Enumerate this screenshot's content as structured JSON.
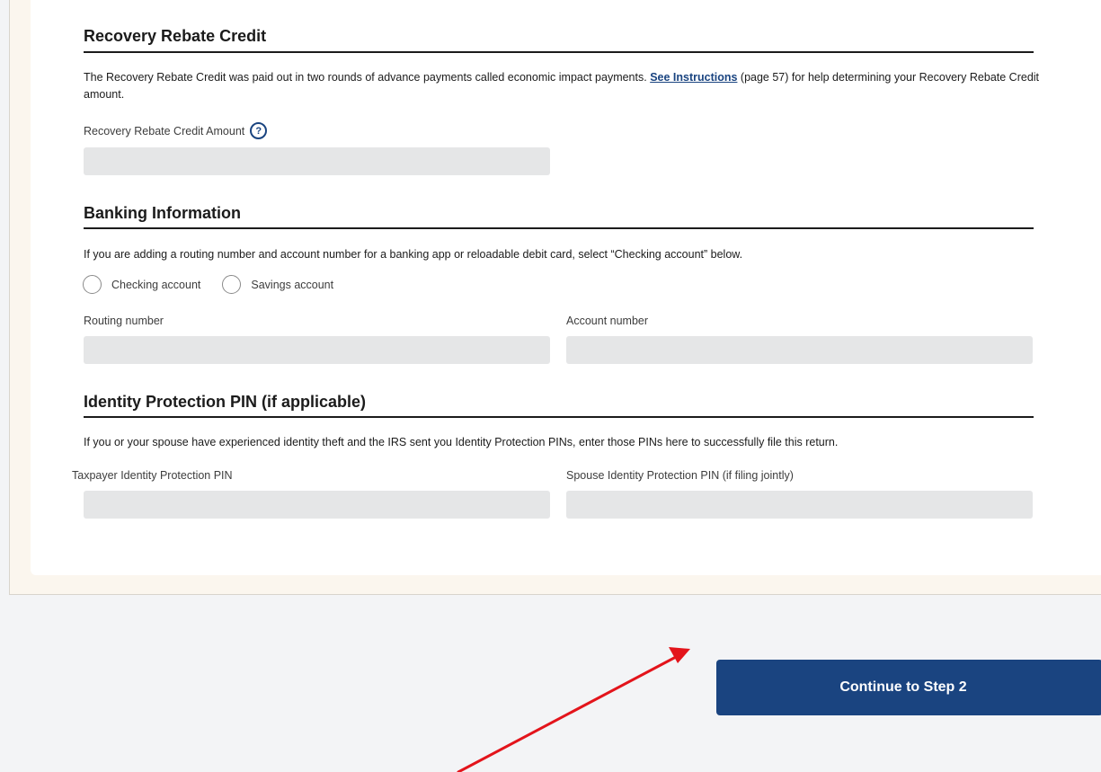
{
  "recovery": {
    "title": "Recovery Rebate Credit",
    "desc_before": "The Recovery Rebate Credit was paid out in two rounds of advance payments called economic impact payments. ",
    "desc_link": "See Instructions",
    "desc_after": " (page 57) for help determining your Recovery Rebate Credit amount.",
    "amount_label": "Recovery Rebate Credit Amount",
    "help_icon": "?",
    "amount_value": ""
  },
  "banking": {
    "title": "Banking Information",
    "desc": "If you are adding a routing number and account number for a banking app or reloadable debit card, select “Checking account” below.",
    "radio_options": [
      "Checking account",
      "Savings account"
    ],
    "routing_label": "Routing number",
    "account_label": "Account number",
    "routing_value": "",
    "account_value": ""
  },
  "ip_pin": {
    "title": "Identity Protection PIN (if applicable)",
    "desc": "If you or your spouse have experienced identity theft and the IRS sent you Identity Protection PINs, enter those PINs here to successfully file this return.",
    "taxpayer_label": "Taxpayer Identity Protection PIN",
    "spouse_label": "Spouse Identity Protection PIN (if filing jointly)",
    "taxpayer_value": "",
    "spouse_value": ""
  },
  "footer": {
    "continue_label": "Continue to Step 2"
  },
  "colors": {
    "primary": "#1a4480",
    "annotation_arrow": "#e3141b",
    "input_bg": "#e5e6e7"
  },
  "icons": {
    "help": "help-circle-icon",
    "annotation": "arrow-annotation-icon"
  }
}
